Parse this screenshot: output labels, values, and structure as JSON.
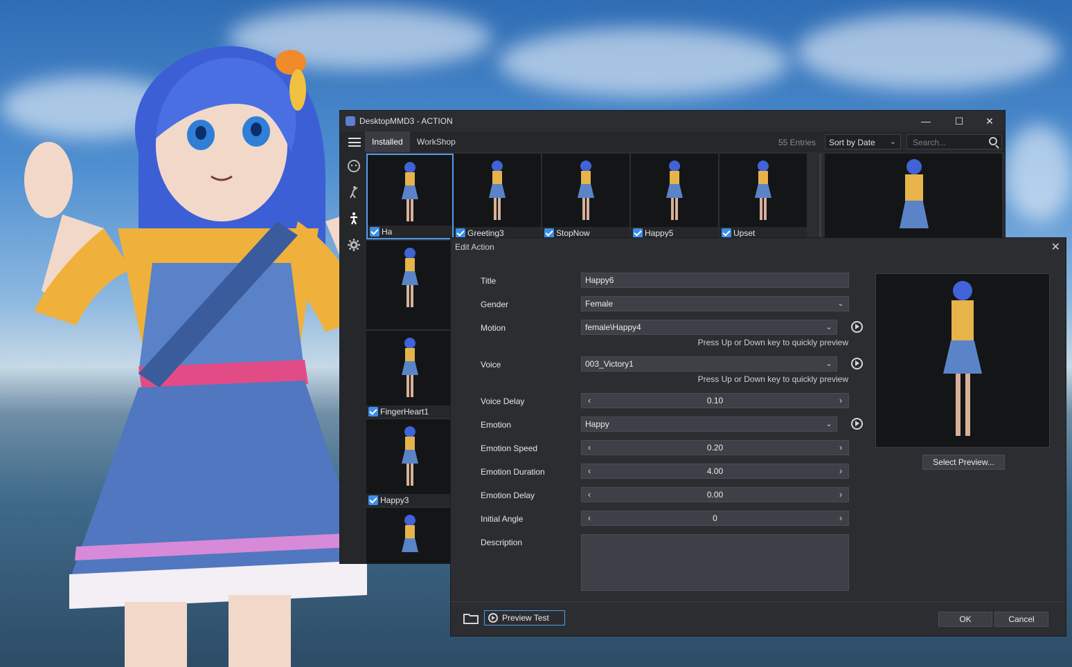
{
  "window": {
    "title": "DesktopMMD3 - ACTION",
    "controls": {
      "minimize": "—",
      "maximize": "☐",
      "close": "✕"
    }
  },
  "tabs": [
    {
      "label": "Installed",
      "active": true
    },
    {
      "label": "WorkShop",
      "active": false
    }
  ],
  "toolbar": {
    "entries": "55 Entries",
    "sort_label": "Sort by Date",
    "search_placeholder": "Search..."
  },
  "sidebar": {
    "icons": [
      "face-icon",
      "dance-icon",
      "action-icon",
      "gear-icon"
    ]
  },
  "thumbnails": [
    {
      "label": "Ha",
      "checked": true,
      "selected": true
    },
    {
      "label": "Greeting3",
      "checked": true
    },
    {
      "label": "StopNow",
      "checked": true
    },
    {
      "label": "Happy5",
      "checked": true
    },
    {
      "label": "Upset",
      "checked": true
    },
    {
      "label": "FingerHeart1",
      "checked": true
    },
    {
      "label": "Happy3",
      "checked": true
    }
  ],
  "dialog": {
    "title": "Edit Action",
    "close": "✕",
    "labels": {
      "title": "Title",
      "gender": "Gender",
      "motion": "Motion",
      "voice": "Voice",
      "voice_delay": "Voice Delay",
      "emotion": "Emotion",
      "emotion_speed": "Emotion Speed",
      "emotion_duration": "Emotion Duration",
      "emotion_delay": "Emotion Delay",
      "initial_angle": "Initial Angle",
      "description": "Description"
    },
    "values": {
      "title": "Happy6",
      "gender": "Female",
      "motion": "female\\Happy4",
      "voice": "003_Victory1",
      "voice_delay": "0.10",
      "emotion": "Happy",
      "emotion_speed": "0.20",
      "emotion_duration": "4.00",
      "emotion_delay": "0.00",
      "initial_angle": "0",
      "description": ""
    },
    "hint": "Press Up or Down key to quickly preview",
    "select_preview": "Select Preview...",
    "preview_test": "Preview Test",
    "ok": "OK",
    "cancel": "Cancel"
  },
  "colors": {
    "accent": "#3c8ee8",
    "window_bg": "#2b2d31",
    "field_bg": "#3d4046"
  }
}
